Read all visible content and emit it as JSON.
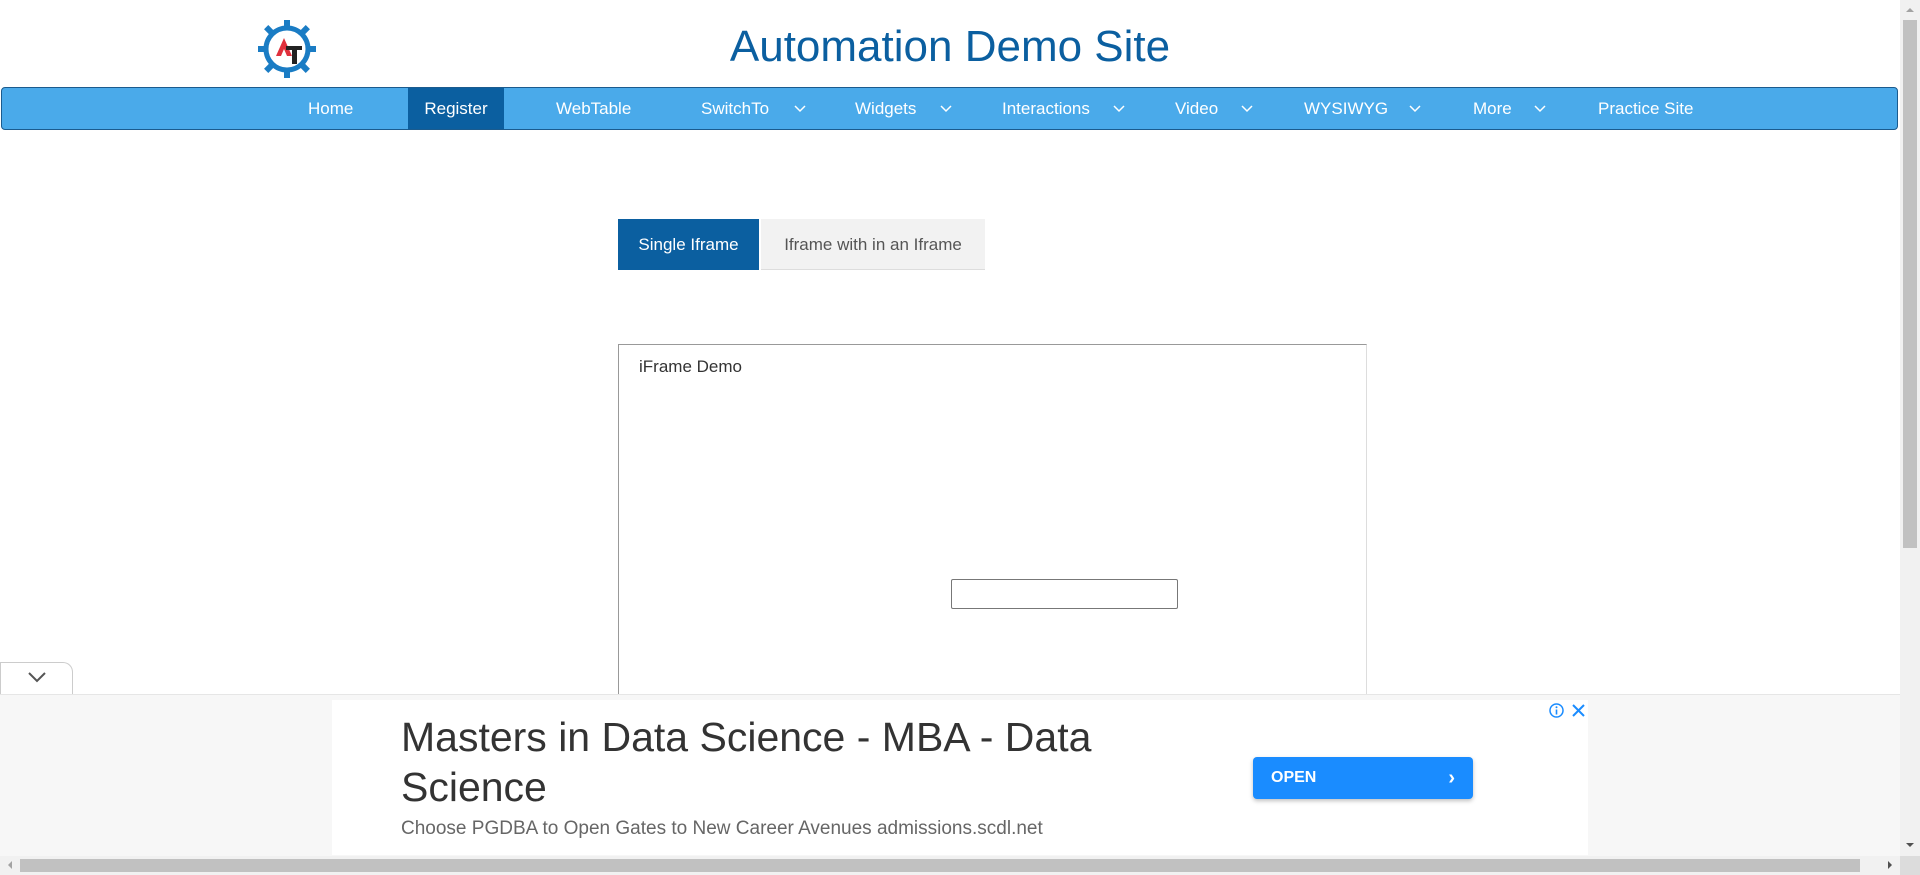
{
  "header": {
    "title": "Automation Demo Site",
    "logo_icon": "gear-at-logo-icon"
  },
  "nav": {
    "items": [
      {
        "label": "Home",
        "dropdown": false
      },
      {
        "label": "Register",
        "dropdown": false,
        "active": true
      },
      {
        "label": "WebTable",
        "dropdown": false
      },
      {
        "label": "SwitchTo",
        "dropdown": true
      },
      {
        "label": "Widgets",
        "dropdown": true
      },
      {
        "label": "Interactions",
        "dropdown": true
      },
      {
        "label": "Video",
        "dropdown": true
      },
      {
        "label": "WYSIWYG",
        "dropdown": true
      },
      {
        "label": "More",
        "dropdown": true
      },
      {
        "label": "Practice Site",
        "dropdown": false
      }
    ]
  },
  "tabs": [
    {
      "label": "Single Iframe",
      "active": true
    },
    {
      "label": "Iframe with in an Iframe",
      "active": false
    }
  ],
  "iframe": {
    "label": "iFrame Demo",
    "input_value": ""
  },
  "ad": {
    "title": "Masters in Data Science - MBA - Data Science",
    "description": "Choose PGDBA to Open Gates to New Career Avenues admissions.scdl.net",
    "button_label": "OPEN"
  },
  "colors": {
    "brand_blue": "#0b5fa0",
    "nav_blue": "#4aaaea",
    "ad_button": "#1a8cff"
  }
}
